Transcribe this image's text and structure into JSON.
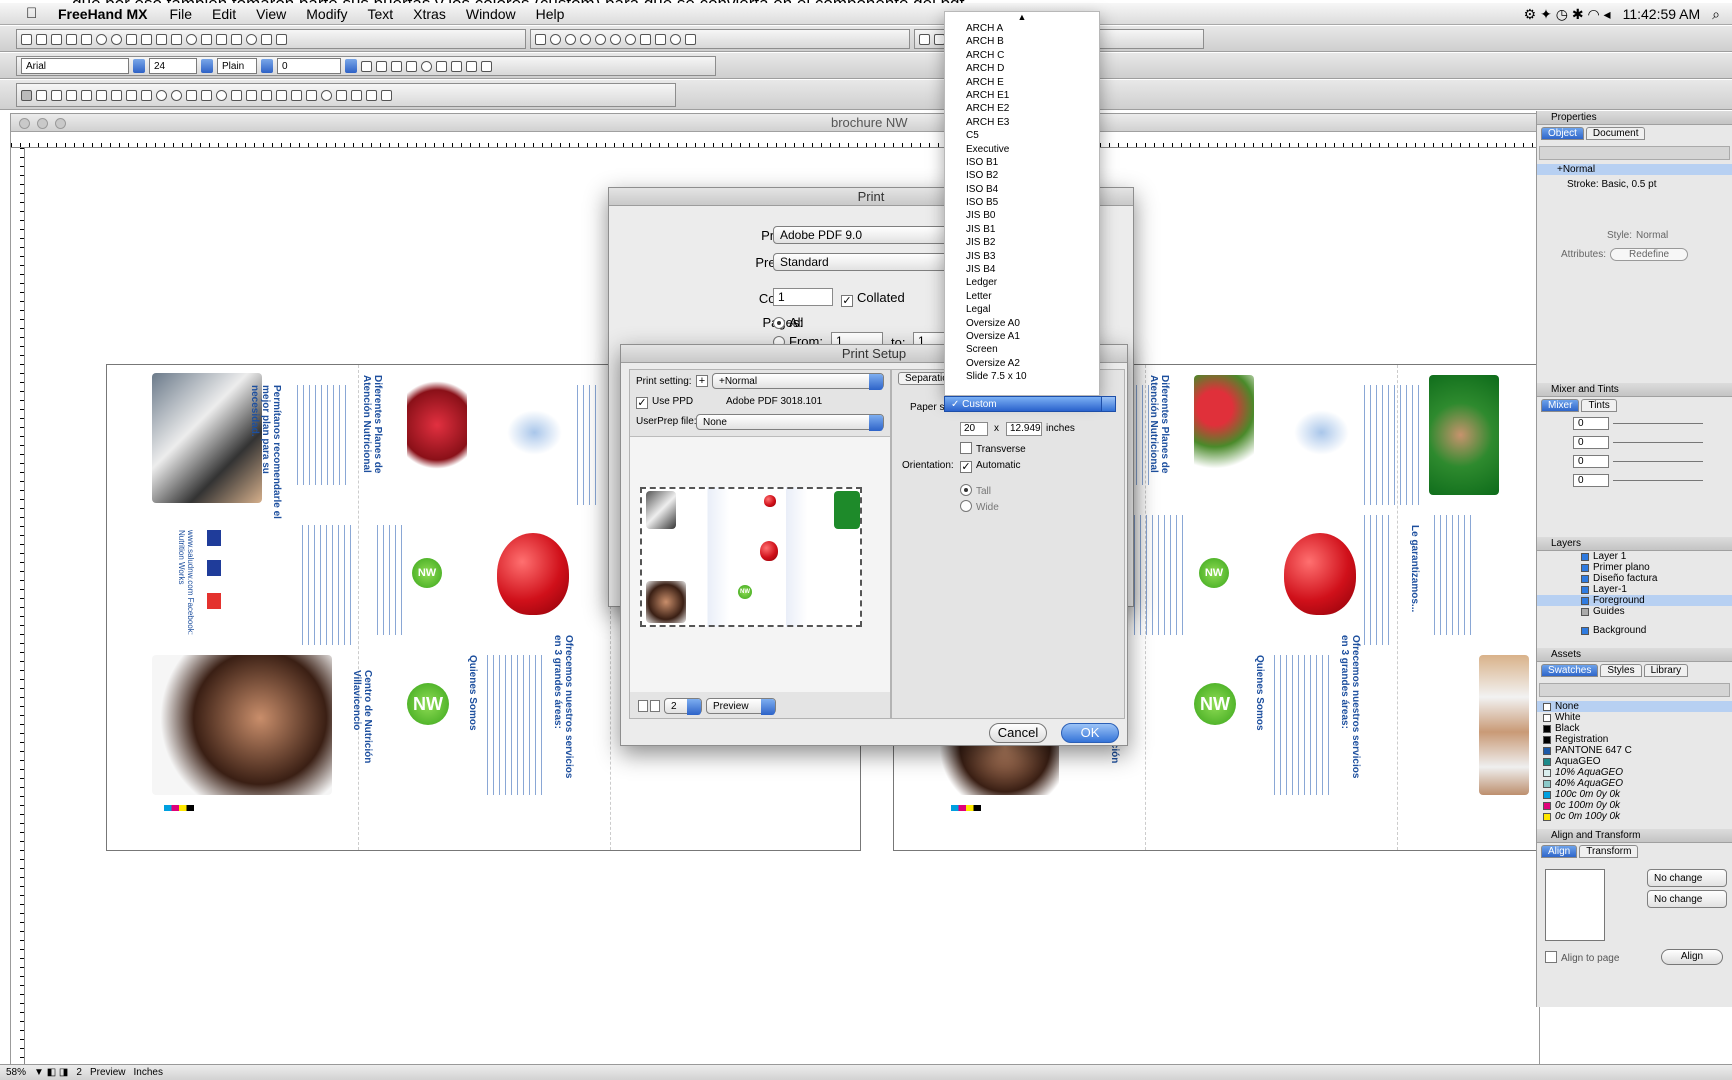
{
  "caption": "...que por eso tambien tomaron parte sus puertas y los colores (custom) para que se convierta en el componente del pdf",
  "menubar": {
    "app": "FreeHand MX",
    "items": [
      "File",
      "Edit",
      "View",
      "Modify",
      "Text",
      "Xtras",
      "Window",
      "Help"
    ],
    "clock": "11:42:59 AM"
  },
  "text_toolbar": {
    "font": "Arial",
    "size": "24",
    "style": "Plain",
    "leading": "0"
  },
  "document": {
    "title": "brochure NW"
  },
  "status": {
    "zoom": "58%",
    "page": "2",
    "view": "Preview",
    "units": "Inches"
  },
  "properties": {
    "title": "Properties",
    "tabs": [
      "Object",
      "Document"
    ],
    "fill_row": "+Normal",
    "stroke_row": "Stroke: Basic, 0.5 pt",
    "style_label": "Style:",
    "style_value": "Normal",
    "attributes_label": "Attributes:",
    "redefine": "Redefine"
  },
  "mixer": {
    "title": "Mixer and Tints",
    "tabs": [
      "Mixer",
      "Tints"
    ],
    "values": [
      "0",
      "0",
      "0",
      "0"
    ]
  },
  "layers": {
    "title": "Layers",
    "items": [
      "Layer 1",
      "Primer plano",
      "Diseño factura",
      "Layer-1",
      "Foreground",
      "Guides",
      "Background"
    ]
  },
  "assets": {
    "title": "Assets",
    "tabs": [
      "Swatches",
      "Styles",
      "Library"
    ],
    "swatches": [
      {
        "name": "None",
        "color": "#ffffff"
      },
      {
        "name": "White",
        "color": "#ffffff"
      },
      {
        "name": "Black",
        "color": "#000000"
      },
      {
        "name": "Registration",
        "color": "#000000"
      },
      {
        "name": "PANTONE 647 C",
        "color": "#1d5aa8"
      },
      {
        "name": "AquaGEO",
        "color": "#1e8a8a"
      },
      {
        "name": "10% AquaGEO",
        "color": "#d9eeee"
      },
      {
        "name": "40% AquaGEO",
        "color": "#8ac8c8"
      },
      {
        "name": "100c 0m 0y 0k",
        "color": "#00a0e0"
      },
      {
        "name": "0c 100m 0y 0k",
        "color": "#e0007a"
      },
      {
        "name": "0c 0m 100y 0k",
        "color": "#ffe800"
      }
    ]
  },
  "align": {
    "title": "Align and Transform",
    "tabs": [
      "Align",
      "Transform"
    ],
    "horizontal": "No change",
    "vertical": "No change",
    "align_to_page": "Align to page",
    "align_button": "Align"
  },
  "print": {
    "title": "Print",
    "printer_label": "Printer:",
    "printer": "Adobe PDF 9.0",
    "presets_label": "Presets:",
    "presets": "Standard",
    "copies_label": "Copies:",
    "copies": "1",
    "collated": "Collated",
    "pages_label": "Pages:",
    "all": "All",
    "from": "From:",
    "from_value": "1",
    "to": "to:",
    "to_value": "1"
  },
  "print_setup": {
    "title": "Print Setup",
    "print_setting_label": "Print setting:",
    "print_setting": "+Normal",
    "use_ppd": "Use PPD",
    "ppd_name": "Adobe PDF 3018.101",
    "userprep_label": "UserPrep file:",
    "userprep": "None",
    "separations_tab": "Separation",
    "paper_size_label": "Paper siz",
    "paper_width": "20",
    "times": "x",
    "paper_height": "12.949",
    "units": "inches",
    "transverse": "Transverse",
    "orientation_label": "Orientation:",
    "automatic": "Automatic",
    "tall": "Tall",
    "wide": "Wide",
    "preview_page": "2",
    "preview_mode": "Preview",
    "cancel": "Cancel",
    "ok": "OK"
  },
  "paper_sizes": {
    "options": [
      "ARCH A",
      "ARCH B",
      "ARCH C",
      "ARCH D",
      "ARCH E",
      "ARCH E1",
      "ARCH E2",
      "ARCH E3",
      "C5",
      "Executive",
      "ISO B1",
      "ISO B2",
      "ISO B4",
      "ISO B5",
      "JIS B0",
      "JIS B1",
      "JIS B2",
      "JIS B3",
      "JIS B4",
      "Ledger",
      "Letter",
      "Legal",
      "Oversize A0",
      "Oversize A1",
      "Screen",
      "Oversize A2",
      "Slide 7.5 x 10"
    ],
    "selected": "✓ Custom"
  },
  "brochure": {
    "heading_a": "Diferentes Planes de Atención Nutricional",
    "heading_b": "Permítanos recomendarle el mejor plan para su necesidad.",
    "heading_c": "Centro de Nutrición Villavicencio",
    "heading_d": "Quienes Somos",
    "heading_e": "Ofrecemos nuestros servicios en 3 grandes áreas:",
    "heading_f": "Le garantizamos...",
    "web": "www.saludnw.com",
    "facebook": "Facebook: Nutrition Works",
    "logo_nw": "NW",
    "brand": "Nutrition Works"
  }
}
